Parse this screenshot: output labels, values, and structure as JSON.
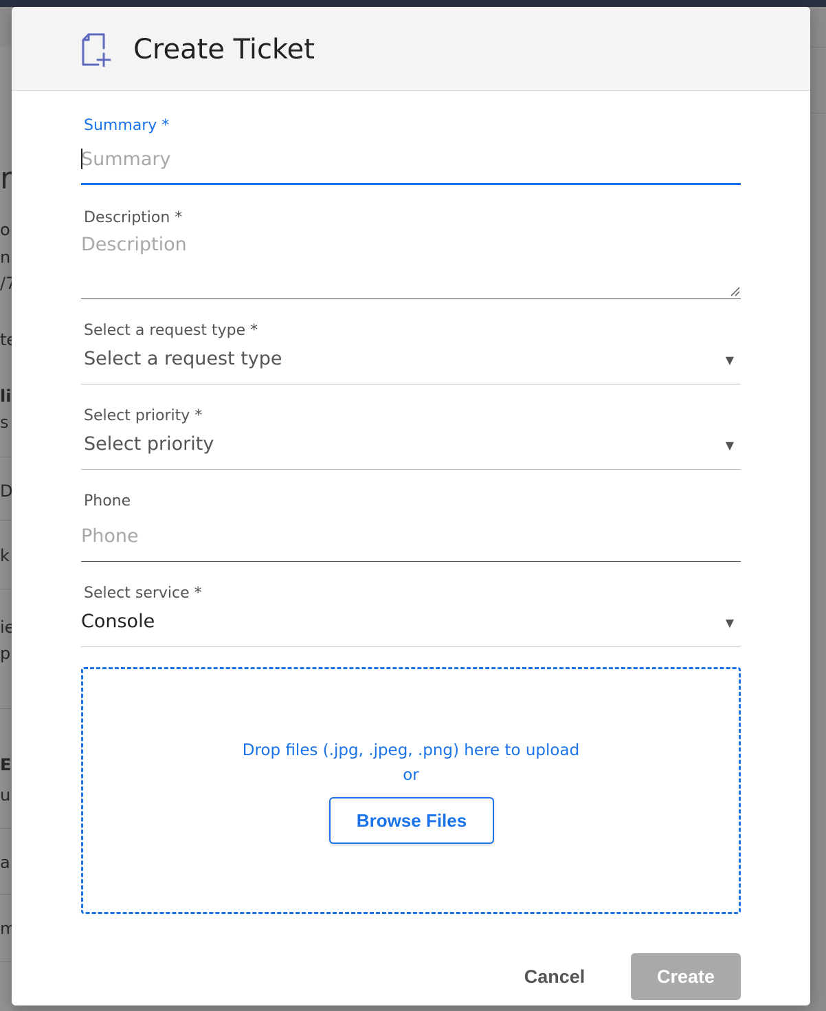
{
  "backdrop": {
    "fragments": [
      "r",
      "o",
      "n",
      "/7",
      "te",
      "li",
      "s",
      "D",
      "k",
      "ie",
      "p",
      "E",
      "u",
      "a",
      "m"
    ]
  },
  "modal": {
    "title": "Create Ticket",
    "icon": "add-document-icon"
  },
  "form": {
    "summary": {
      "label": "Summary *",
      "placeholder": "Summary",
      "value": ""
    },
    "description": {
      "label": "Description *",
      "placeholder": "Description",
      "value": ""
    },
    "request_type": {
      "label": "Select a request type *",
      "value": "Select a request type"
    },
    "priority": {
      "label": "Select priority *",
      "value": "Select priority"
    },
    "phone": {
      "label": "Phone",
      "placeholder": "Phone",
      "value": ""
    },
    "service": {
      "label": "Select service *",
      "value": "Console"
    }
  },
  "dropzone": {
    "instruction": "Drop files (.jpg, .jpeg, .png) here to upload",
    "or": "or",
    "browse_label": "Browse Files"
  },
  "actions": {
    "cancel_label": "Cancel",
    "create_label": "Create"
  },
  "colors": {
    "accent": "#1a73e8",
    "disabled_button": "#a9a9a9",
    "header_bg": "#f4f4f4"
  }
}
